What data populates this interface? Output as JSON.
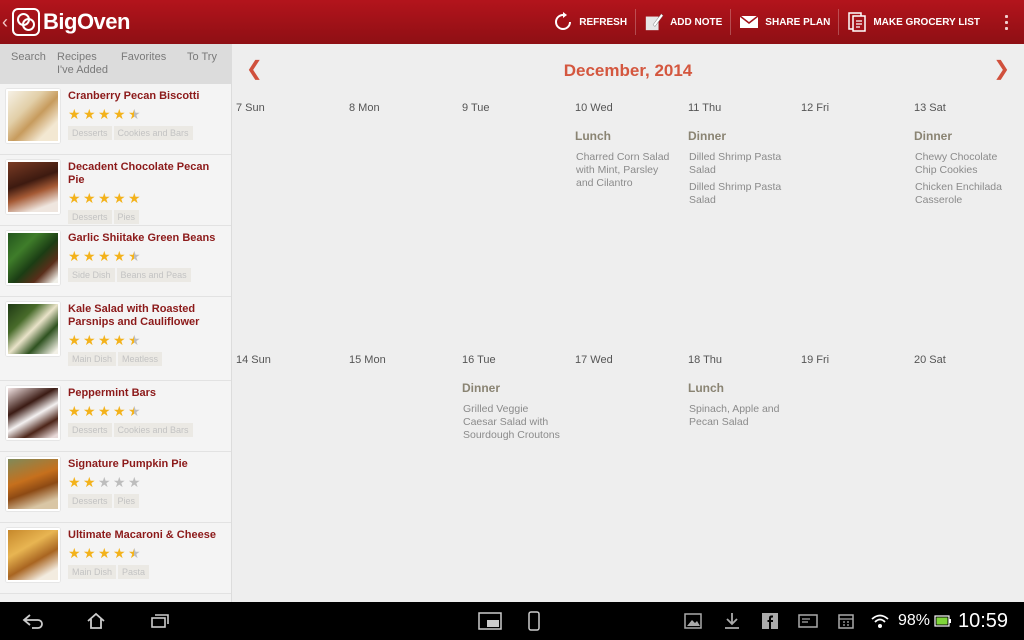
{
  "app": {
    "name": "BigOven"
  },
  "toolbar": {
    "refresh": "REFRESH",
    "add_note": "ADD NOTE",
    "share_plan": "SHARE PLAN",
    "grocery": "MAKE GROCERY LIST"
  },
  "sidebar": {
    "tabs": [
      "Search",
      "Recipes\nI've Added",
      "Favorites",
      "To Try"
    ],
    "recipes": [
      {
        "title": "Cranberry Pecan Biscotti",
        "rating": 4.5,
        "tags": [
          "Desserts",
          "Cookies and Bars"
        ]
      },
      {
        "title": "Decadent Chocolate Pecan Pie",
        "rating": 5,
        "tags": [
          "Desserts",
          "Pies"
        ]
      },
      {
        "title": "Garlic Shiitake Green Beans",
        "rating": 4.5,
        "tags": [
          "Side Dish",
          "Beans and Peas"
        ]
      },
      {
        "title": "Kale Salad with Roasted Parsnips and Cauliflower",
        "rating": 4.5,
        "tags": [
          "Main Dish",
          "Meatless"
        ]
      },
      {
        "title": "Peppermint Bars",
        "rating": 4.5,
        "tags": [
          "Desserts",
          "Cookies and Bars"
        ]
      },
      {
        "title": "Signature Pumpkin Pie",
        "rating": 2,
        "tags": [
          "Desserts",
          "Pies"
        ]
      },
      {
        "title": "Ultimate Macaroni & Cheese",
        "rating": 4.5,
        "tags": [
          "Main Dish",
          "Pasta"
        ]
      }
    ]
  },
  "calendar": {
    "month_title": "December, 2014",
    "weeks": [
      [
        {
          "label": "7 Sun"
        },
        {
          "label": "8 Mon"
        },
        {
          "label": "9 Tue"
        },
        {
          "label": "10 Wed",
          "meal": "Lunch",
          "items": [
            "Charred Corn Salad with Mint, Parsley and Cilantro"
          ]
        },
        {
          "label": "11 Thu",
          "meal": "Dinner",
          "items": [
            "Dilled Shrimp Pasta Salad",
            "Dilled Shrimp Pasta Salad"
          ]
        },
        {
          "label": "12 Fri"
        },
        {
          "label": "13 Sat",
          "meal": "Dinner",
          "items": [
            "Chewy Chocolate Chip Cookies",
            "Chicken Enchilada Casserole"
          ]
        }
      ],
      [
        {
          "label": "14 Sun"
        },
        {
          "label": "15 Mon"
        },
        {
          "label": "16 Tue",
          "meal": "Dinner",
          "items": [
            "Grilled Veggie Caesar Salad with Sourdough Croutons"
          ]
        },
        {
          "label": "17 Wed"
        },
        {
          "label": "18 Thu",
          "meal": "Lunch",
          "items": [
            "Spinach, Apple and Pecan Salad"
          ]
        },
        {
          "label": "19 Fri"
        },
        {
          "label": "20 Sat"
        }
      ]
    ]
  },
  "status": {
    "battery": "98%",
    "time": "10:59"
  },
  "colors": {
    "brand_red": "#a3121a",
    "accent_orange": "#d4573f",
    "star_gold": "#f3b21b"
  }
}
